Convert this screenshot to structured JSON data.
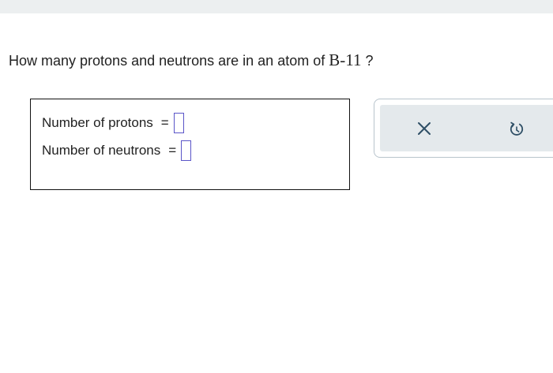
{
  "question": {
    "prefix": "How many protons and neutrons are in an atom of ",
    "formula": "B-11",
    "suffix": " ?"
  },
  "answer": {
    "protons_label": "Number of protons",
    "neutrons_label": "Number of neutrons",
    "equals": "=",
    "protons_value": "",
    "neutrons_value": ""
  },
  "tools": {
    "clear_icon": "x-icon",
    "undo_icon": "undo-icon"
  },
  "colors": {
    "input_border": "#5a55c8",
    "tool_icon": "#2f4f66",
    "tool_bg": "#e4e9ec"
  }
}
